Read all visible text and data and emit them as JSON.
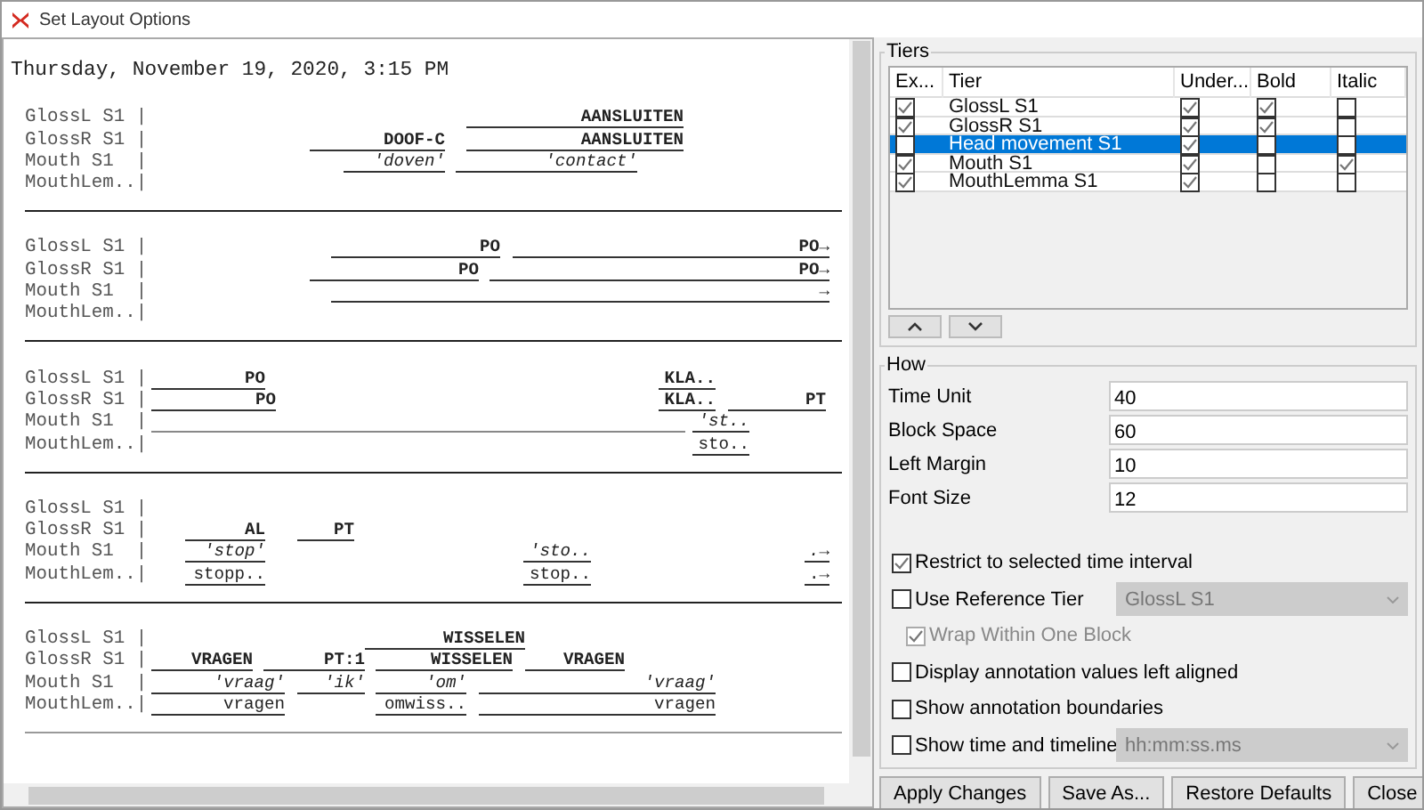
{
  "window": {
    "title": "Set Layout Options"
  },
  "preview": {
    "date": "Thursday, November 19, 2020, 3:15 PM",
    "blocks": [
      {
        "rows": [
          {
            "label": "GlossL S1 |",
            "annotations": [
              {
                "text": "AANSLUITEN"
              }
            ]
          },
          {
            "label": "GlossR S1 |",
            "annotations": [
              {
                "text": "DOOF-C"
              },
              {
                "text": "AANSLUITEN"
              }
            ]
          },
          {
            "label": "Mouth S1  |",
            "annotations": [
              {
                "text": "'doven'"
              },
              {
                "text": "'contact'"
              }
            ]
          },
          {
            "label": "MouthLem..|",
            "annotations": []
          }
        ]
      },
      {
        "rows": [
          {
            "label": "GlossL S1 |",
            "annotations": [
              {
                "text": "PO"
              },
              {
                "text": "PO→"
              }
            ]
          },
          {
            "label": "GlossR S1 |",
            "annotations": [
              {
                "text": "PO"
              },
              {
                "text": "PO→"
              }
            ]
          },
          {
            "label": "Mouth S1  |",
            "annotations": [
              {
                "text": "→"
              }
            ]
          },
          {
            "label": "MouthLem..|",
            "annotations": []
          }
        ]
      },
      {
        "rows": [
          {
            "label": "GlossL S1 |",
            "annotations": [
              {
                "text": "PO"
              },
              {
                "text": "KLA.."
              }
            ]
          },
          {
            "label": "GlossR S1 |",
            "annotations": [
              {
                "text": "PO"
              },
              {
                "text": "KLA.."
              },
              {
                "text": "PT"
              }
            ]
          },
          {
            "label": "Mouth S1  |",
            "annotations": [
              {
                "kind": "blank"
              },
              {
                "text": "'st.."
              }
            ]
          },
          {
            "label": "MouthLem..|",
            "annotations": [
              {
                "text": "sto.."
              }
            ]
          }
        ]
      },
      {
        "rows": [
          {
            "label": "GlossL S1 |",
            "annotations": []
          },
          {
            "label": "GlossR S1 |",
            "annotations": [
              {
                "text": "AL"
              },
              {
                "text": "PT"
              }
            ]
          },
          {
            "label": "Mouth S1  |",
            "annotations": [
              {
                "text": "'stop'"
              },
              {
                "text": "'sto.."
              },
              {
                "text": ".→"
              }
            ]
          },
          {
            "label": "MouthLem..|",
            "annotations": [
              {
                "text": "stopp.."
              },
              {
                "text": "stop.."
              },
              {
                "text": ".→"
              }
            ]
          }
        ]
      },
      {
        "rows": [
          {
            "label": "GlossL S1 |",
            "annotations": [
              {
                "text": "WISSELEN"
              }
            ]
          },
          {
            "label": "GlossR S1 |",
            "annotations": [
              {
                "text": "VRAGEN"
              },
              {
                "text": "PT:1"
              },
              {
                "text": "WISSELEN"
              },
              {
                "text": "VRAGEN"
              }
            ]
          },
          {
            "label": "Mouth S1  |",
            "annotations": [
              {
                "text": "'vraag'"
              },
              {
                "text": "'ik'"
              },
              {
                "text": "'om'"
              },
              {
                "text": "'vraag'"
              }
            ]
          },
          {
            "label": "MouthLem..|",
            "annotations": [
              {
                "text": "vragen"
              },
              {
                "text": "omwiss.."
              },
              {
                "text": "vragen"
              }
            ]
          }
        ]
      }
    ]
  },
  "tiers": {
    "title": "Tiers",
    "columns": [
      "Ex...",
      "Tier",
      "Under...",
      "Bold",
      "Italic"
    ],
    "rows": [
      {
        "export": true,
        "name": "GlossL S1",
        "underline": true,
        "bold": true,
        "italic": false,
        "selected": false
      },
      {
        "export": true,
        "name": "GlossR S1",
        "underline": true,
        "bold": true,
        "italic": false,
        "selected": false
      },
      {
        "export": false,
        "name": "Head movement S1",
        "underline": true,
        "bold": false,
        "italic": false,
        "selected": true
      },
      {
        "export": true,
        "name": "Mouth S1",
        "underline": true,
        "bold": false,
        "italic": true,
        "selected": false
      },
      {
        "export": true,
        "name": "MouthLemma S1",
        "underline": true,
        "bold": false,
        "italic": false,
        "selected": false
      }
    ]
  },
  "how": {
    "title": "How",
    "fields": [
      {
        "label": "Time Unit",
        "value": "40"
      },
      {
        "label": "Block Space",
        "value": "60"
      },
      {
        "label": "Left Margin",
        "value": "10"
      },
      {
        "label": "Font Size",
        "value": "12"
      }
    ],
    "options": [
      {
        "label": "Restrict to selected time interval",
        "checked": true,
        "disabled": false,
        "indented": false
      },
      {
        "label": "Use Reference Tier",
        "checked": false,
        "disabled": false,
        "indented": false,
        "select": {
          "value": "GlossL S1",
          "disabled": true
        }
      },
      {
        "label": "Wrap Within One Block",
        "checked": true,
        "disabled": true,
        "indented": true
      },
      {
        "label": "Display annotation values left aligned",
        "checked": false,
        "disabled": false,
        "indented": false
      },
      {
        "label": "Show annotation boundaries",
        "checked": false,
        "disabled": false,
        "indented": false
      },
      {
        "label": "Show time and timeline",
        "checked": false,
        "disabled": false,
        "indented": false,
        "select": {
          "value": "hh:mm:ss.ms",
          "disabled": true
        }
      }
    ]
  },
  "buttons": [
    "Apply Changes",
    "Save As...",
    "Restore Defaults",
    "Close"
  ]
}
